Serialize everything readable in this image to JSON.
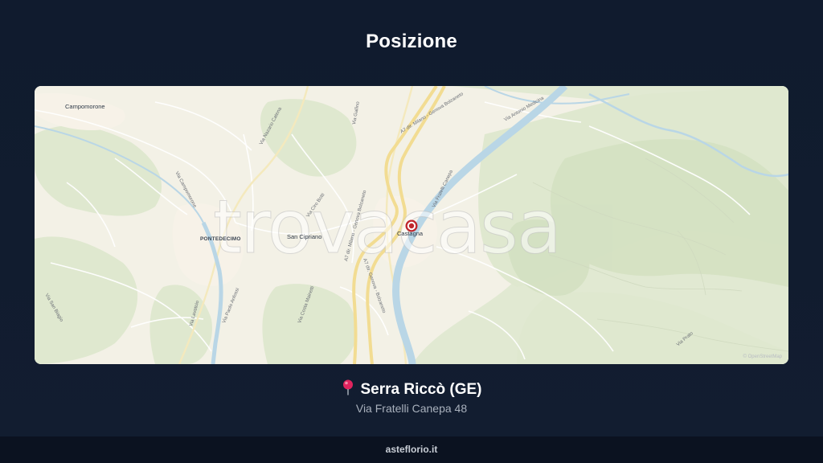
{
  "page": {
    "title": "Posizione"
  },
  "map": {
    "labels": {
      "campomorone": "Campomorone",
      "pontedecimo": "PONTEDECIMO",
      "san_cipriano": "San Cipriano",
      "castagna": "Castagna"
    },
    "road_labels": {
      "via_nazario": "Via Nazario Catena",
      "via_campomorone": "Via Campomorone",
      "via_fratelli_canepa": "Via Fratelli Canepa",
      "via_antonio_medicina": "Via Antonio Medicina",
      "a7_milano_1": "A7 dir. Milano - Genova Bolzaneto",
      "a7_milano_2": "A7 dir. Milano - Genova Bolzaneto",
      "a7_genova": "A7 dir. Genova - Bolzaneto",
      "via_paolo": "Via Paolo Anfossi",
      "via_lavatoio": "Via Lavatoio",
      "via_gallino": "Via Gallino",
      "via_san_biagio": "Via San Biagio",
      "via_carlo": "Via Costa Mainetti",
      "via_ciro": "Via Ciro Botti",
      "via_prato": "Via Prato"
    },
    "watermark": "trovacasa",
    "attribution": "© OpenStreetMap",
    "marker_color": "#c0272d",
    "river_color": "#b9d6e6",
    "motorway_color": "#f2dc92"
  },
  "location": {
    "pin_icon": "round-pushpin-icon",
    "name": "Serra Riccò (GE)",
    "address": "Via Fratelli Canepa 48"
  },
  "footer": {
    "site": "asteflorio.it"
  }
}
